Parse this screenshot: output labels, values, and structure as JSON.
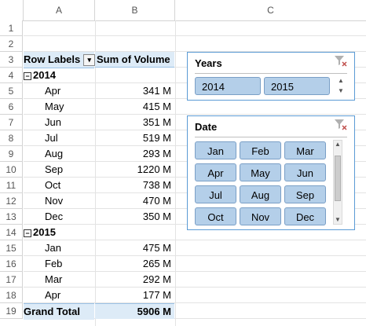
{
  "columns": [
    "A",
    "B",
    "C"
  ],
  "rows": [
    "1",
    "2",
    "3",
    "4",
    "5",
    "6",
    "7",
    "8",
    "9",
    "10",
    "11",
    "12",
    "13",
    "14",
    "15",
    "16",
    "17",
    "18",
    "19"
  ],
  "pivot": {
    "header_row_labels": "Row Labels",
    "header_sum": "Sum of Volume",
    "filter_glyph": "▾",
    "collapse_glyph": "−",
    "entries": [
      {
        "label": "2014",
        "value": "",
        "type": "group"
      },
      {
        "label": "Apr",
        "value": "341 M",
        "type": "item"
      },
      {
        "label": "May",
        "value": "415 M",
        "type": "item"
      },
      {
        "label": "Jun",
        "value": "351 M",
        "type": "item"
      },
      {
        "label": "Jul",
        "value": "519 M",
        "type": "item"
      },
      {
        "label": "Aug",
        "value": "293 M",
        "type": "item"
      },
      {
        "label": "Sep",
        "value": "1220 M",
        "type": "item"
      },
      {
        "label": "Oct",
        "value": "738 M",
        "type": "item"
      },
      {
        "label": "Nov",
        "value": "470 M",
        "type": "item"
      },
      {
        "label": "Dec",
        "value": "350 M",
        "type": "item"
      },
      {
        "label": "2015",
        "value": "",
        "type": "group"
      },
      {
        "label": "Jan",
        "value": "475 M",
        "type": "item"
      },
      {
        "label": "Feb",
        "value": "265 M",
        "type": "item"
      },
      {
        "label": "Mar",
        "value": "292 M",
        "type": "item"
      },
      {
        "label": "Apr",
        "value": "177 M",
        "type": "item"
      }
    ],
    "grand_total_label": "Grand Total",
    "grand_total_value": "5906 M"
  },
  "slicer_years": {
    "title": "Years",
    "clear_icon": "filter-clear-icon",
    "buttons": [
      "2014",
      "2015"
    ],
    "scroll_up": "▲",
    "scroll_down": "▼"
  },
  "slicer_date": {
    "title": "Date",
    "clear_icon": "filter-clear-icon",
    "buttons": [
      "Jan",
      "Feb",
      "Mar",
      "Apr",
      "May",
      "Jun",
      "Jul",
      "Aug",
      "Sep",
      "Oct",
      "Nov",
      "Dec"
    ],
    "scroll_up": "▲",
    "scroll_down": "▼"
  },
  "colors": {
    "pivot_header_fill": "#ddebf7",
    "slicer_border": "#5b9bd5",
    "slicer_button_fill": "#b4cfe9"
  }
}
